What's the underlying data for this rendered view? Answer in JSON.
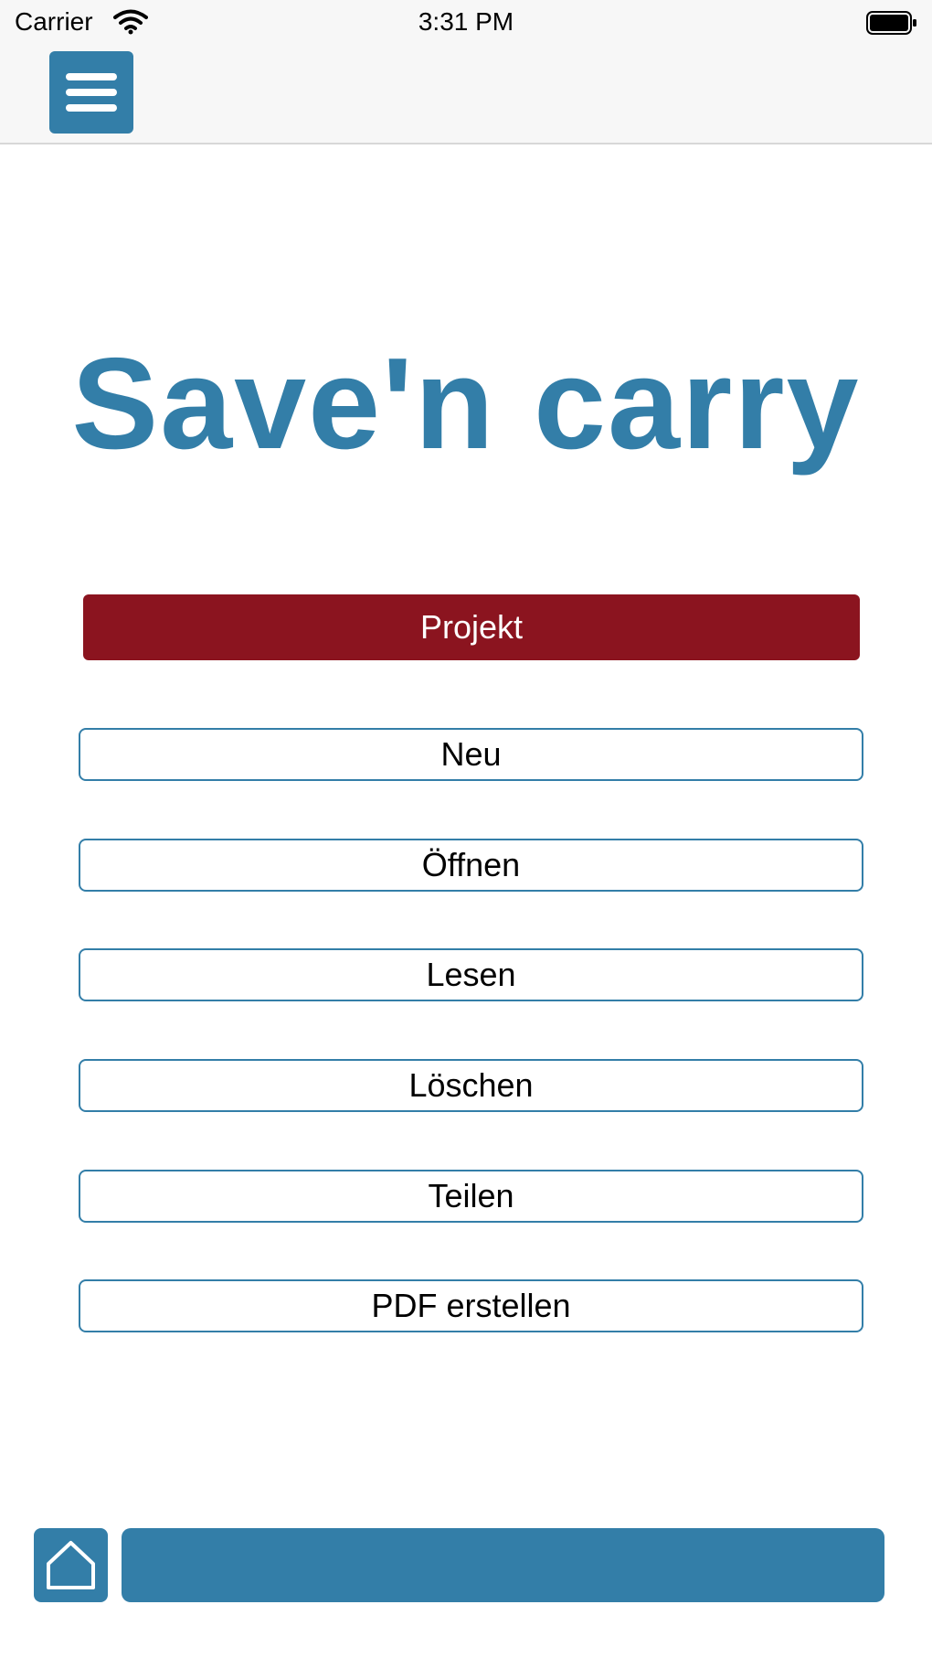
{
  "status_bar": {
    "carrier": "Carrier",
    "time": "3:31 PM",
    "wifi_icon": "wifi-icon",
    "battery_icon": "battery-icon"
  },
  "nav": {
    "menu_icon": "hamburger-menu-icon"
  },
  "app": {
    "title": "Save'n carry"
  },
  "project_section": {
    "header": "Projekt",
    "buttons": [
      {
        "label": "Neu"
      },
      {
        "label": "Öffnen"
      },
      {
        "label": "Lesen"
      },
      {
        "label": "Löschen"
      },
      {
        "label": "Teilen"
      },
      {
        "label": "PDF erstellen"
      }
    ]
  },
  "bottom": {
    "home_icon": "home-icon"
  },
  "colors": {
    "accent": "#337ea8",
    "header_red": "#8b141f",
    "background": "#ffffff"
  }
}
